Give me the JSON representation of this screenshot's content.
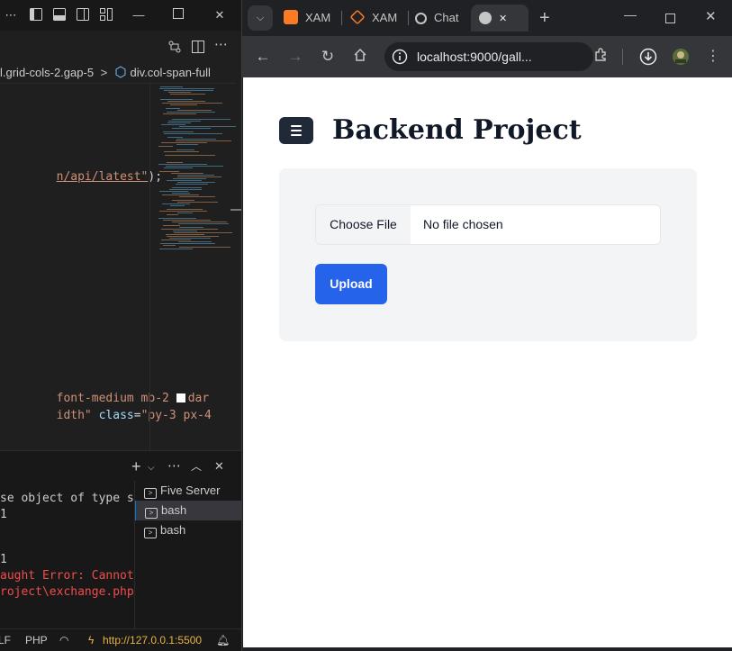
{
  "vscode": {
    "breadcrumb": {
      "segment1": "l.grid-cols-2.gap-5",
      "separator": ">",
      "segment2": "div.col-span-full"
    },
    "code": {
      "line1_str": "n/api/latest\"",
      "line1_tail": ");",
      "line2": "font-medium mb-2 ",
      "line2_tail": "dar",
      "line3_str": "idth\" ",
      "line3_attr": "class",
      "line3_eq": "=",
      "line3_val": "\"py-3 px-4"
    },
    "terminal": {
      "lines": [
        "se object of type s",
        "1",
        "1",
        "aught Error: Cannot",
        "roject\\exchange.php"
      ],
      "list": [
        "Five Server",
        "bash",
        "bash"
      ]
    },
    "status": {
      "eol": "LF",
      "language": "PHP",
      "server": "http://127.0.0.1:5500"
    }
  },
  "browser": {
    "tabs": [
      {
        "label": "XAM",
        "icon": "xampp-icon",
        "color": "#fb7a24"
      },
      {
        "label": "XAM",
        "icon": "xampp-icon",
        "color": "#fb7a24"
      },
      {
        "label": "Chat",
        "icon": "openai-icon",
        "color": "#c4c7c5"
      },
      {
        "label": "",
        "icon": "globe-icon",
        "color": "#c4c7c5"
      }
    ],
    "new_tab": "+",
    "url": "localhost:9000/gall...",
    "page": {
      "title": "Backend Project",
      "file_button": "Choose File",
      "file_status": "No file chosen",
      "upload": "Upload"
    }
  },
  "colors": {
    "primary": "#2563eb",
    "menu_button": "#1f2937",
    "card_bg": "#f3f4f6"
  }
}
